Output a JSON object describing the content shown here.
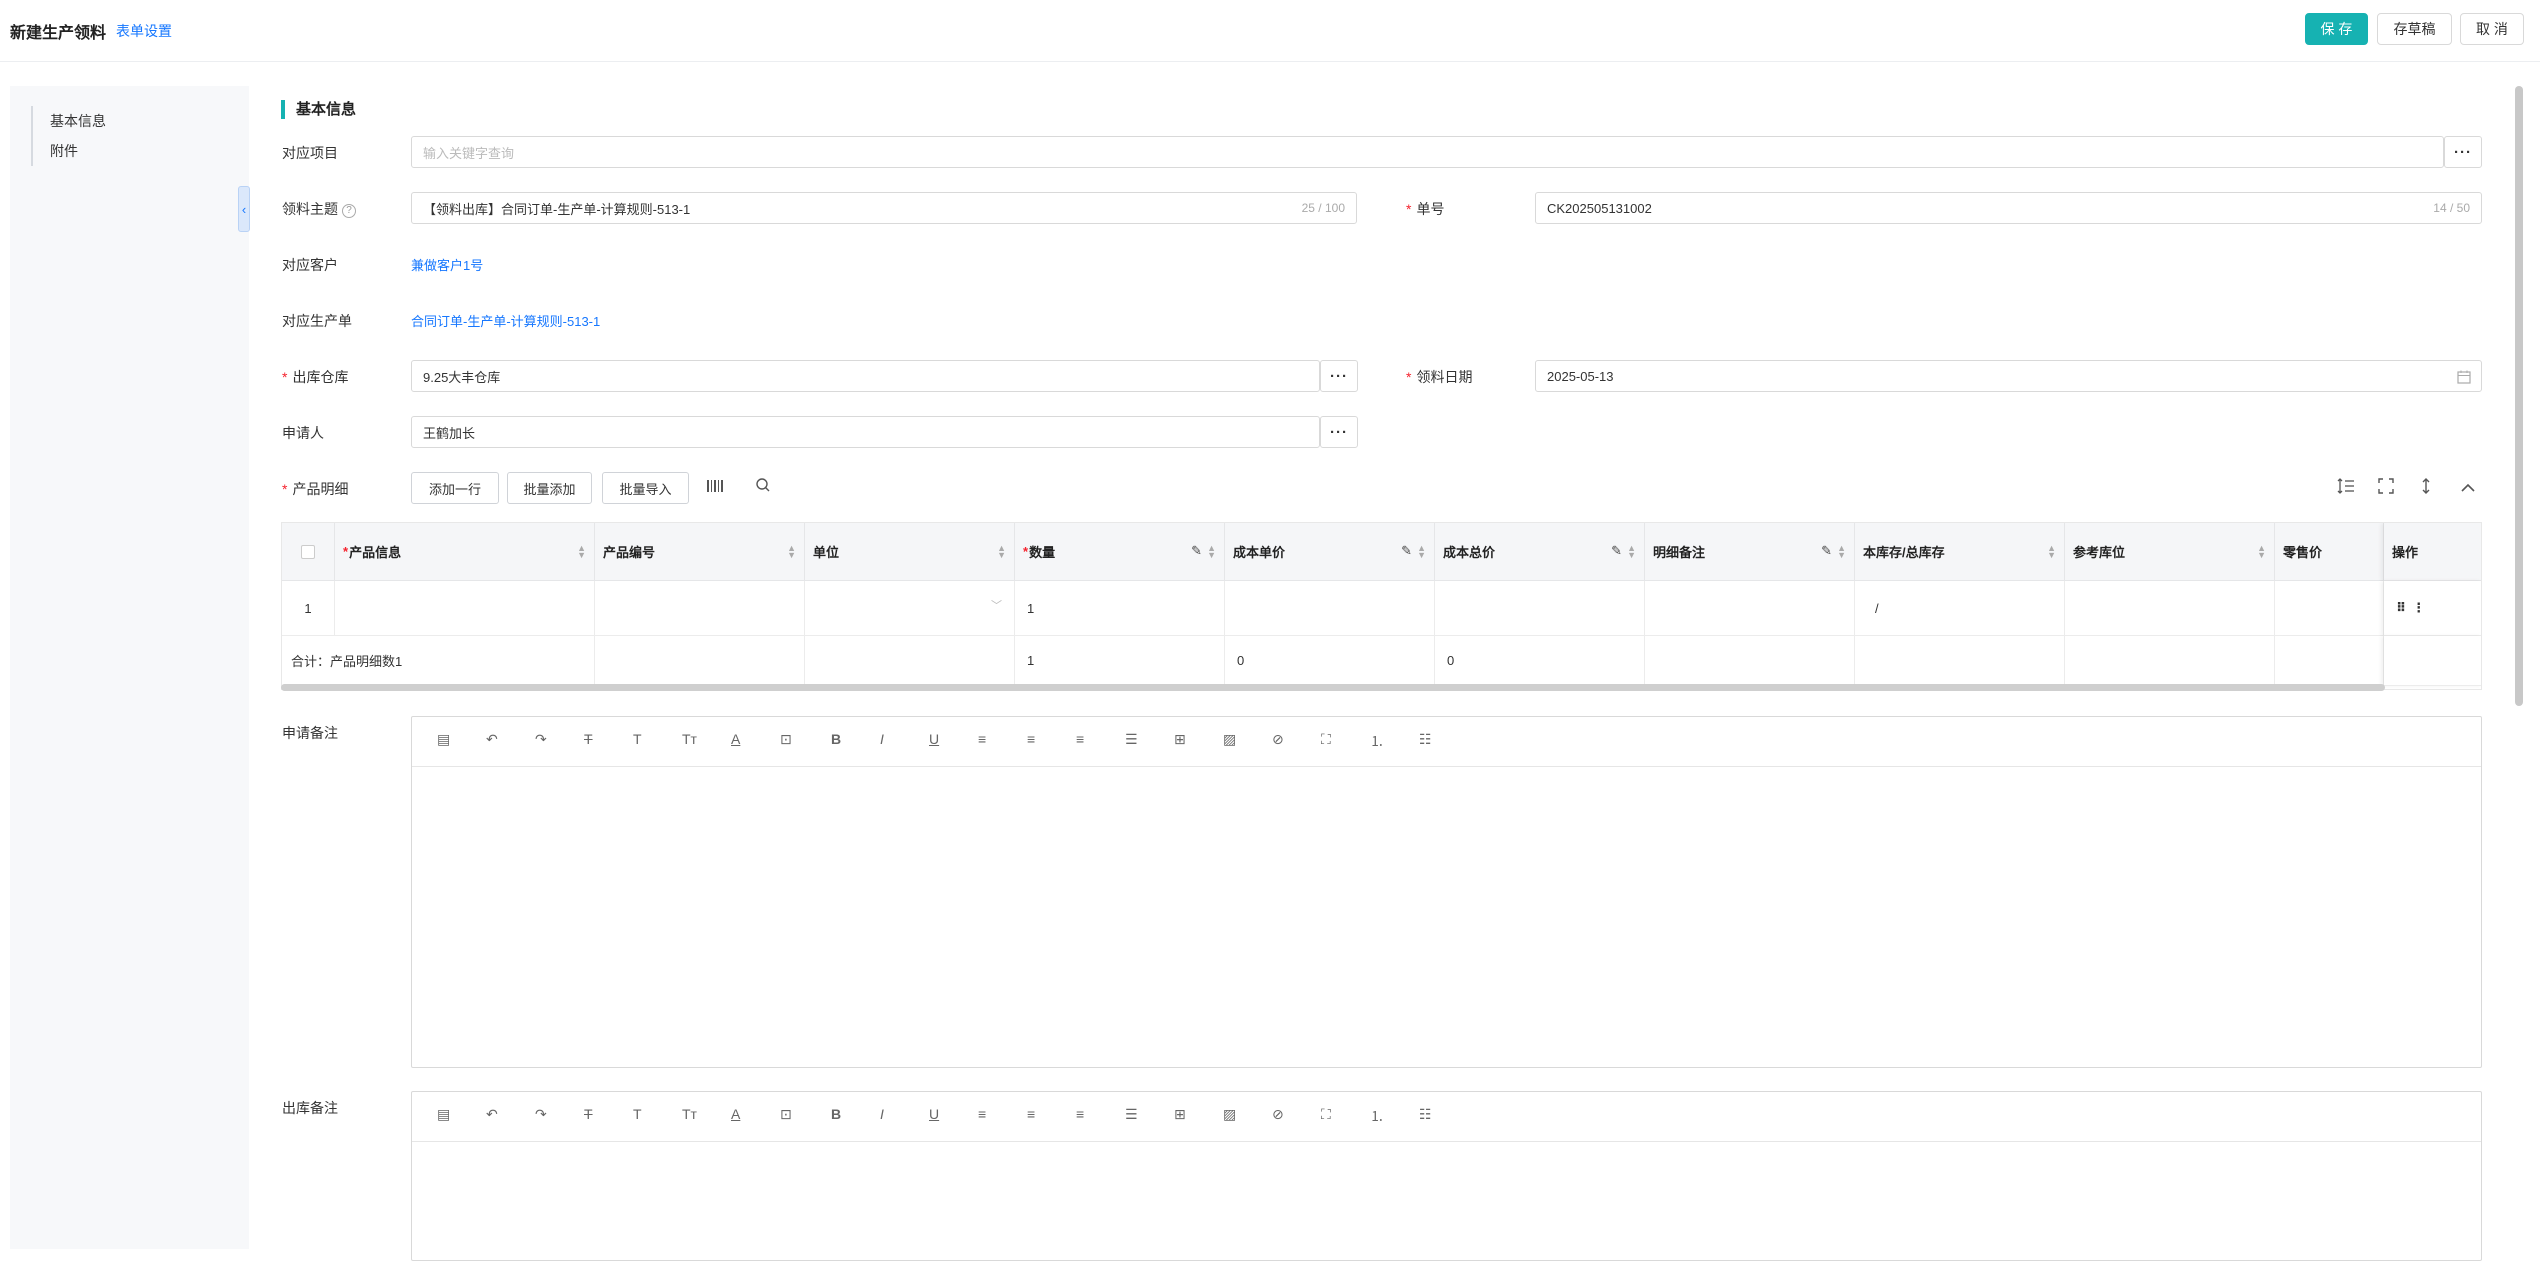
{
  "header": {
    "title": "新建生产领料",
    "form_settings": "表单设置",
    "save": "保 存",
    "draft": "存草稿",
    "cancel": "取 消"
  },
  "sidebar": {
    "items": [
      "基本信息",
      "附件"
    ]
  },
  "section": {
    "title": "基本信息"
  },
  "fields": {
    "project": {
      "label": "对应项目",
      "placeholder": "输入关键字查询"
    },
    "subject": {
      "label": "领料主题",
      "value": "【领料出库】合同订单-生产单-计算规则-513-1",
      "counter": "25 / 100"
    },
    "order_no": {
      "label": "单号",
      "value": "CK202505131002",
      "counter": "14 / 50"
    },
    "customer": {
      "label": "对应客户",
      "value": "兼做客户1号"
    },
    "production": {
      "label": "对应生产单",
      "value": "合同订单-生产单-计算规则-513-1"
    },
    "warehouse": {
      "label": "出库仓库",
      "value": "9.25大丰仓库"
    },
    "date": {
      "label": "领料日期",
      "value": "2025-05-13"
    },
    "applicant": {
      "label": "申请人",
      "value": "王鹤加长"
    },
    "products": {
      "label": "产品明细"
    }
  },
  "toolbar": {
    "add_row": "添加一行",
    "batch_add": "批量添加",
    "batch_import": "批量导入"
  },
  "table": {
    "columns": [
      "产品信息",
      "产品编号",
      "单位",
      "数量",
      "成本单价",
      "成本总价",
      "明细备注",
      "本库存/总库存",
      "参考库位",
      "零售价",
      "操作"
    ],
    "row": {
      "index": "1",
      "quantity": "1",
      "stock": "/"
    },
    "total": {
      "label": "合计：产品明细数1",
      "quantity": "1",
      "unit_price": "0",
      "total_price": "0"
    }
  },
  "remarks": {
    "apply": "申请备注",
    "outbound": "出库备注"
  },
  "colors": {
    "accent": "#16b2b2",
    "link": "#1677ff",
    "required": "#f5222d"
  }
}
